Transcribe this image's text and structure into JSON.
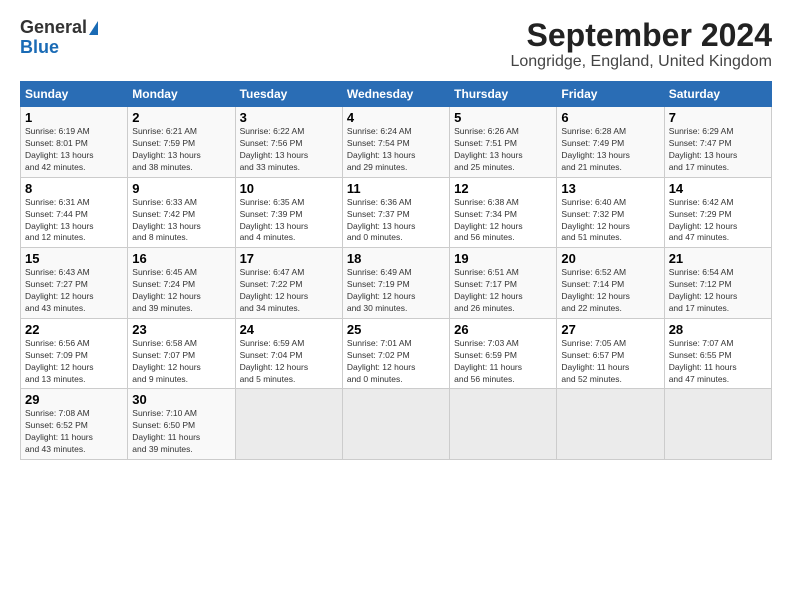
{
  "header": {
    "logo_general": "General",
    "logo_blue": "Blue",
    "title": "September 2024",
    "subtitle": "Longridge, England, United Kingdom"
  },
  "days_of_week": [
    "Sunday",
    "Monday",
    "Tuesday",
    "Wednesday",
    "Thursday",
    "Friday",
    "Saturday"
  ],
  "weeks": [
    [
      {
        "day": "1",
        "info": "Sunrise: 6:19 AM\nSunset: 8:01 PM\nDaylight: 13 hours\nand 42 minutes."
      },
      {
        "day": "2",
        "info": "Sunrise: 6:21 AM\nSunset: 7:59 PM\nDaylight: 13 hours\nand 38 minutes."
      },
      {
        "day": "3",
        "info": "Sunrise: 6:22 AM\nSunset: 7:56 PM\nDaylight: 13 hours\nand 33 minutes."
      },
      {
        "day": "4",
        "info": "Sunrise: 6:24 AM\nSunset: 7:54 PM\nDaylight: 13 hours\nand 29 minutes."
      },
      {
        "day": "5",
        "info": "Sunrise: 6:26 AM\nSunset: 7:51 PM\nDaylight: 13 hours\nand 25 minutes."
      },
      {
        "day": "6",
        "info": "Sunrise: 6:28 AM\nSunset: 7:49 PM\nDaylight: 13 hours\nand 21 minutes."
      },
      {
        "day": "7",
        "info": "Sunrise: 6:29 AM\nSunset: 7:47 PM\nDaylight: 13 hours\nand 17 minutes."
      }
    ],
    [
      {
        "day": "8",
        "info": "Sunrise: 6:31 AM\nSunset: 7:44 PM\nDaylight: 13 hours\nand 12 minutes."
      },
      {
        "day": "9",
        "info": "Sunrise: 6:33 AM\nSunset: 7:42 PM\nDaylight: 13 hours\nand 8 minutes."
      },
      {
        "day": "10",
        "info": "Sunrise: 6:35 AM\nSunset: 7:39 PM\nDaylight: 13 hours\nand 4 minutes."
      },
      {
        "day": "11",
        "info": "Sunrise: 6:36 AM\nSunset: 7:37 PM\nDaylight: 13 hours\nand 0 minutes."
      },
      {
        "day": "12",
        "info": "Sunrise: 6:38 AM\nSunset: 7:34 PM\nDaylight: 12 hours\nand 56 minutes."
      },
      {
        "day": "13",
        "info": "Sunrise: 6:40 AM\nSunset: 7:32 PM\nDaylight: 12 hours\nand 51 minutes."
      },
      {
        "day": "14",
        "info": "Sunrise: 6:42 AM\nSunset: 7:29 PM\nDaylight: 12 hours\nand 47 minutes."
      }
    ],
    [
      {
        "day": "15",
        "info": "Sunrise: 6:43 AM\nSunset: 7:27 PM\nDaylight: 12 hours\nand 43 minutes."
      },
      {
        "day": "16",
        "info": "Sunrise: 6:45 AM\nSunset: 7:24 PM\nDaylight: 12 hours\nand 39 minutes."
      },
      {
        "day": "17",
        "info": "Sunrise: 6:47 AM\nSunset: 7:22 PM\nDaylight: 12 hours\nand 34 minutes."
      },
      {
        "day": "18",
        "info": "Sunrise: 6:49 AM\nSunset: 7:19 PM\nDaylight: 12 hours\nand 30 minutes."
      },
      {
        "day": "19",
        "info": "Sunrise: 6:51 AM\nSunset: 7:17 PM\nDaylight: 12 hours\nand 26 minutes."
      },
      {
        "day": "20",
        "info": "Sunrise: 6:52 AM\nSunset: 7:14 PM\nDaylight: 12 hours\nand 22 minutes."
      },
      {
        "day": "21",
        "info": "Sunrise: 6:54 AM\nSunset: 7:12 PM\nDaylight: 12 hours\nand 17 minutes."
      }
    ],
    [
      {
        "day": "22",
        "info": "Sunrise: 6:56 AM\nSunset: 7:09 PM\nDaylight: 12 hours\nand 13 minutes."
      },
      {
        "day": "23",
        "info": "Sunrise: 6:58 AM\nSunset: 7:07 PM\nDaylight: 12 hours\nand 9 minutes."
      },
      {
        "day": "24",
        "info": "Sunrise: 6:59 AM\nSunset: 7:04 PM\nDaylight: 12 hours\nand 5 minutes."
      },
      {
        "day": "25",
        "info": "Sunrise: 7:01 AM\nSunset: 7:02 PM\nDaylight: 12 hours\nand 0 minutes."
      },
      {
        "day": "26",
        "info": "Sunrise: 7:03 AM\nSunset: 6:59 PM\nDaylight: 11 hours\nand 56 minutes."
      },
      {
        "day": "27",
        "info": "Sunrise: 7:05 AM\nSunset: 6:57 PM\nDaylight: 11 hours\nand 52 minutes."
      },
      {
        "day": "28",
        "info": "Sunrise: 7:07 AM\nSunset: 6:55 PM\nDaylight: 11 hours\nand 47 minutes."
      }
    ],
    [
      {
        "day": "29",
        "info": "Sunrise: 7:08 AM\nSunset: 6:52 PM\nDaylight: 11 hours\nand 43 minutes."
      },
      {
        "day": "30",
        "info": "Sunrise: 7:10 AM\nSunset: 6:50 PM\nDaylight: 11 hours\nand 39 minutes."
      },
      {
        "day": "",
        "info": ""
      },
      {
        "day": "",
        "info": ""
      },
      {
        "day": "",
        "info": ""
      },
      {
        "day": "",
        "info": ""
      },
      {
        "day": "",
        "info": ""
      }
    ]
  ]
}
